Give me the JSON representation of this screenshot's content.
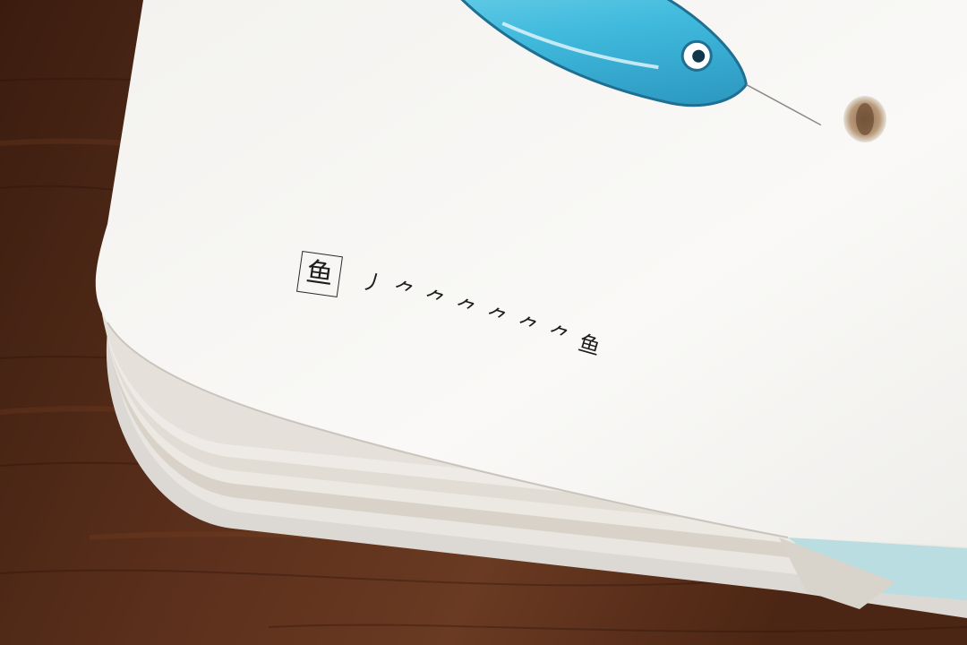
{
  "card": {
    "character": "鱼",
    "stroke_steps": [
      "丿",
      "⺈",
      "⺈",
      "⺈",
      "⺈",
      "⺈",
      "⺈",
      "鱼"
    ]
  },
  "colors": {
    "table_wood": "#4a2616",
    "card_white": "#f7f6f3",
    "fish_blue": "#4cc3e3"
  },
  "icons": {
    "fish_illustration": "fish-icon",
    "binding_hole": "hole-icon"
  }
}
